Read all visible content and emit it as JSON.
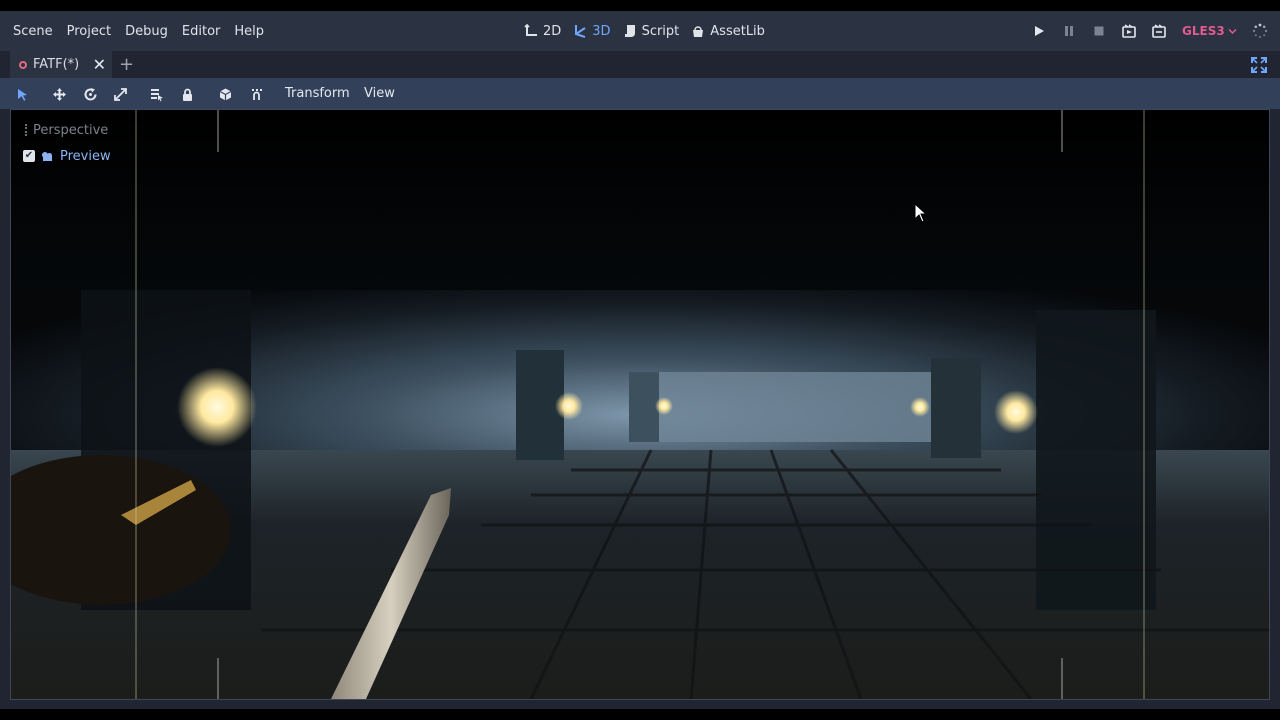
{
  "menubar": {
    "menus": [
      "Scene",
      "Project",
      "Debug",
      "Editor",
      "Help"
    ],
    "main_screens": {
      "two_d": "2D",
      "three_d": "3D",
      "script": "Script",
      "assetlib": "AssetLib"
    },
    "renderer": "GLES3"
  },
  "tabs": {
    "scene_tab_label": "FATF(*)",
    "close_glyph": "✕",
    "add_glyph": "+"
  },
  "toolbar": {
    "transform_menu": "Transform",
    "view_menu": "View"
  },
  "viewport": {
    "perspective_label": "Perspective",
    "preview_label": "Preview",
    "preview_checked": true
  },
  "colors": {
    "accent": "#6fa6ff",
    "renderer": "#e25a8e",
    "menubar_bg": "#2b3241",
    "toolbar_bg": "#33405a"
  },
  "icons": {
    "select": "select-arrow-icon",
    "move": "move-icon",
    "rotate": "rotate-icon",
    "scale": "scale-icon",
    "list_select": "list-select-icon",
    "lock": "lock-icon",
    "mesh": "mesh-cube-icon",
    "snap": "snap-icon",
    "play": "play-icon",
    "pause": "pause-icon",
    "stop": "stop-icon",
    "play_scene": "play-scene-icon",
    "play_custom": "play-custom-scene-icon",
    "expand": "expand-icon"
  }
}
